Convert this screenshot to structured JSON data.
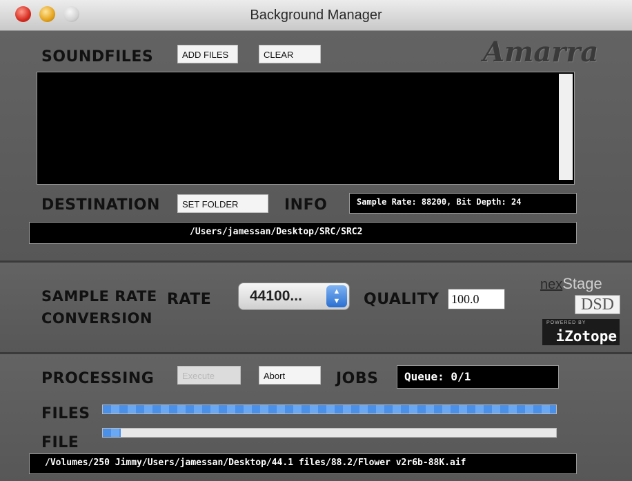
{
  "window": {
    "title": "Background Manager"
  },
  "brand": {
    "logo_text": "Amarra"
  },
  "soundfiles": {
    "heading": "SOUNDFILES",
    "add_files_label": "ADD FILES",
    "clear_label": "CLEAR"
  },
  "destination": {
    "heading": "DESTINATION",
    "set_folder_label": "SET FOLDER",
    "info_heading": "INFO",
    "info_text": "Sample Rate:  88200, Bit Depth: 24",
    "path": "/Users/jamessan/Desktop/SRC/SRC2"
  },
  "src": {
    "heading_line1": "SAMPLE RATE",
    "heading_line2": "CONVERSION",
    "rate_label": "RATE",
    "rate_value": "44100...",
    "quality_label": "QUALITY",
    "quality_value": "100.0"
  },
  "badges": {
    "nexstage_nex": "nex",
    "nexstage_stage": "Stage",
    "dsd": "DSD",
    "izotope_powered": "POWERED BY",
    "izotope_name": "iZotope"
  },
  "processing": {
    "heading": "PROCESSING",
    "execute_label": "Execute",
    "abort_label": "Abort",
    "jobs_label": "JOBS",
    "queue_text": "Queue: 0/1",
    "files_label": "FILES",
    "file_label": "FILE",
    "files_progress": 1.0,
    "file_progress": 0.04,
    "current_file": "/Volumes/250 Jimmy/Users/jamessan/Desktop/44.1 files/88.2/Flower v2r6b-88K.aif"
  },
  "colors": {
    "progress_blue": "#4a8fe8",
    "panel_gray": "#5a5a5a"
  }
}
